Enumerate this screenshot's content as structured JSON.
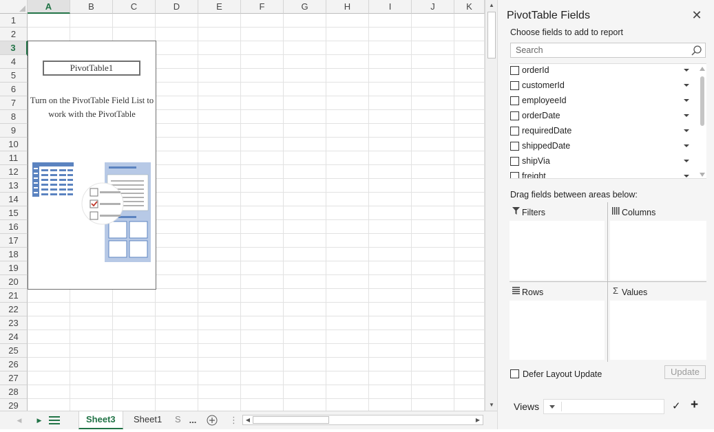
{
  "sheet": {
    "columns": [
      "A",
      "B",
      "C",
      "D",
      "E",
      "F",
      "G",
      "H",
      "I",
      "J",
      "K"
    ],
    "selected_column": "A",
    "rows": [
      "1",
      "2",
      "3",
      "4",
      "5",
      "6",
      "7",
      "8",
      "9",
      "10",
      "11",
      "12",
      "13",
      "14",
      "15",
      "16",
      "17",
      "18",
      "19",
      "20",
      "21",
      "22",
      "23",
      "24",
      "25",
      "26",
      "27",
      "28",
      "29"
    ],
    "selected_row": "3",
    "pivot_placeholder": {
      "title": "PivotTable1",
      "message": "Turn on the PivotTable Field List to work with the PivotTable"
    }
  },
  "tabbar": {
    "tabs": [
      {
        "label": "Sheet3",
        "active": true
      },
      {
        "label": "Sheet1",
        "active": false
      },
      {
        "label": "S",
        "active": false
      }
    ],
    "more_label": "..."
  },
  "panel": {
    "title": "PivotTable Fields",
    "close_icon": "close-icon",
    "choose_label": "Choose fields to add to report",
    "search": {
      "placeholder": "Search",
      "value": ""
    },
    "fields": [
      {
        "name": "orderId",
        "checked": false
      },
      {
        "name": "customerId",
        "checked": false
      },
      {
        "name": "employeeId",
        "checked": false
      },
      {
        "name": "orderDate",
        "checked": false
      },
      {
        "name": "requiredDate",
        "checked": false
      },
      {
        "name": "shippedDate",
        "checked": false
      },
      {
        "name": "shipVia",
        "checked": false
      },
      {
        "name": "freight",
        "checked": false
      }
    ],
    "drag_label": "Drag fields between areas below:",
    "areas": {
      "filters": "Filters",
      "columns": "Columns",
      "rows": "Rows",
      "values": "Values"
    },
    "defer": {
      "label": "Defer Layout Update",
      "checked": false
    },
    "update_label": "Update",
    "views_label": "Views",
    "views_value": ""
  },
  "colors": {
    "accent": "#217346",
    "panel_bg": "#f5f5f5",
    "header_bg": "#f3f3f3",
    "pivot_blue": "#5b83c0"
  }
}
